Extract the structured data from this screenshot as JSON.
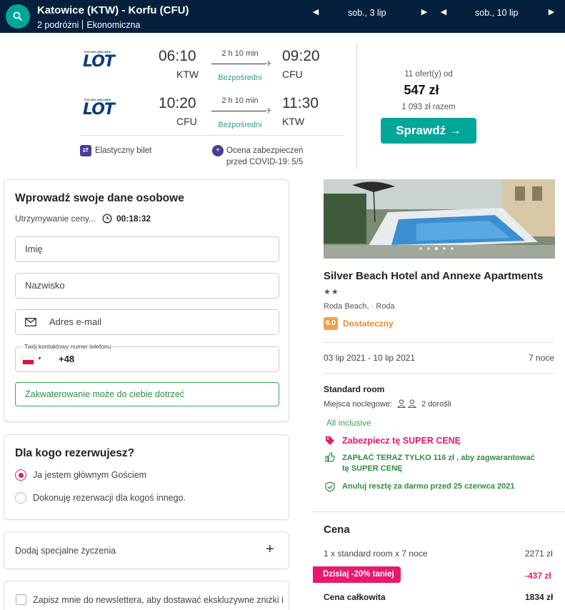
{
  "header": {
    "route": "Katowice (KTW) - Korfu (CFU)",
    "travellers": "2 podróżni",
    "cabin": "Ekonomiczna",
    "depart_date": "sob., 3 lip",
    "return_date": "sob., 10 lip"
  },
  "flights": {
    "airline_small": "POLISH AIRLINES",
    "airline": "LOT",
    "outbound": {
      "dep_time": "06:10",
      "dep_code": "KTW",
      "duration": "2 h 10 min",
      "stops": "Bezpośredni",
      "arr_time": "09:20",
      "arr_code": "CFU"
    },
    "inbound": {
      "dep_time": "10:20",
      "dep_code": "CFU",
      "duration": "2 h 10 min",
      "stops": "Bezpośredni",
      "arr_time": "11:30",
      "arr_code": "KTW"
    },
    "flex": "Elastyczny bilet",
    "covid_line1": "Ocena zabezpieczeń",
    "covid_line2": "przed COVID-19: 5/5",
    "offers": "11 ofert(y) od",
    "price": "547 zł",
    "price_total": "1 093 zł razem",
    "check_button": "Sprawdź →"
  },
  "personal": {
    "title": "Wprowadź swoje dane osobowe",
    "hold_label": "Utrzymywanie ceny...",
    "timer": "00:18:32",
    "first_name_placeholder": "Imię",
    "last_name_placeholder": "Nazwisko",
    "email_placeholder": "Adres e-mail",
    "phone_label": "Twój kontaktowy numer telefonu",
    "phone_prefix": "+48",
    "hint": "Zakwaterowanie może do ciebie dotrzeć"
  },
  "booking_for": {
    "title": "Dla kogo rezerwujesz?",
    "option_self": "Ja jestem głównym Gościem",
    "option_other": "Dokonuję rezerwacji dla kogoś innego."
  },
  "special": {
    "label": "Dodaj specjalne życzenia",
    "plus": "+"
  },
  "newsletter": {
    "label": "Zapisz mnie do newslettera, aby dostawać ekskluzywne zniżki i"
  },
  "hotel": {
    "name": "Silver Beach Hotel and Annexe Apartments",
    "stars": "★★",
    "location": "Roda Beach, · Roda",
    "score": "6.0",
    "score_label": "Dostateczny",
    "dates": "03 lip 2021 - 10 lip 2021",
    "nights": "7 noce",
    "room": "Standard room",
    "beds_label": "Miejsca noclegowe:",
    "guests": "2 dorośli",
    "board": "All inclusive",
    "promo1": "Zabezpiecz tę SUPER CENĘ",
    "promo2_line1": "ZAPŁAĆ TERAZ TYLKO 116 zł , aby zagwarantować",
    "promo2_line2": "tę SUPER CENĘ",
    "promo3": "Anuluj resztę za darmo przed 25 czerwca 2021"
  },
  "price_box": {
    "title": "Cena",
    "line_label": "1 x standard room  x 7 noce",
    "line_value": "2271 zł",
    "discount_label": "Dzisiaj -20% taniej",
    "discount_value": "-437 zł",
    "total_label": "Cena całkowita",
    "total_value": "1834 zł"
  },
  "colors": {
    "navy": "#05203c",
    "teal": "#00a698",
    "pink": "#e8196d",
    "green": "#39a852",
    "orange": "#f29e4c"
  }
}
